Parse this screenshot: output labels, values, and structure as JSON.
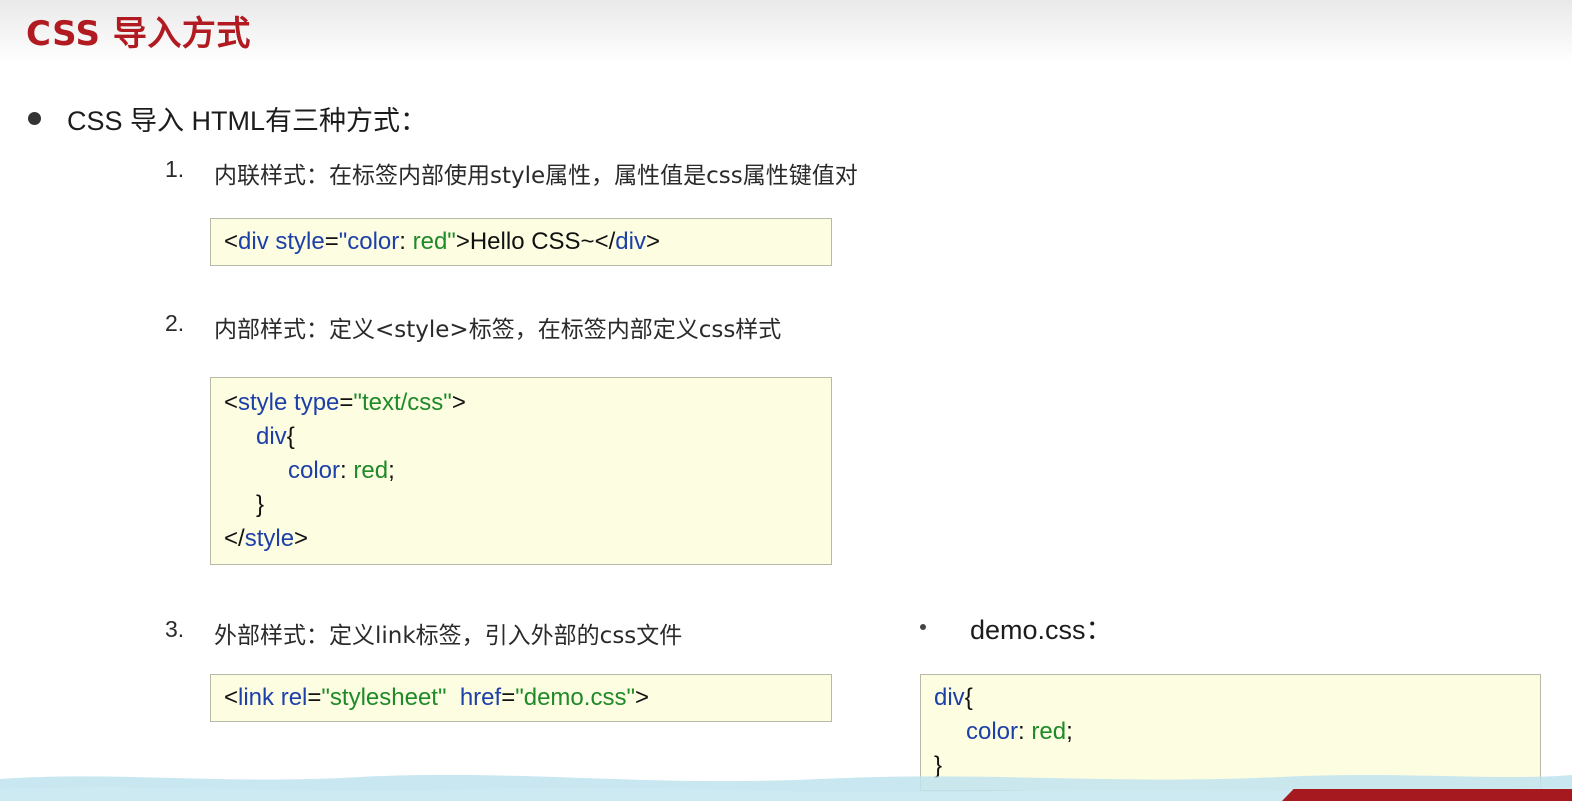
{
  "title": "CSS 导入方式",
  "intro": "CSS 导入 HTML有三种方式：",
  "items": [
    {
      "num": "1.",
      "text": "内联样式：在标签内部使用style属性，属性值是css属性键值对"
    },
    {
      "num": "2.",
      "text": "内部样式：定义<style>标签，在标签内部定义css样式"
    },
    {
      "num": "3.",
      "text": "外部样式：定义link标签，引入外部的css文件"
    }
  ],
  "code1": {
    "lt": "<",
    "tag": "div",
    "attr": " style",
    "eq": "=",
    "val": "\"color",
    "colon": ":",
    "val2": " red\"",
    "gt": ">",
    "content": "Hello CSS~",
    "close_lt": "</",
    "close_tag": "div",
    "close_gt": ">"
  },
  "code2": {
    "l1_lt": "<",
    "l1_tag": "style",
    "l1_attr": " type",
    "l1_eq": "=",
    "l1_val": "\"text/css\"",
    "l1_gt": ">",
    "l2_sel": "div",
    "l2_brace": "{",
    "l3_prop": "color",
    "l3_colon": ":",
    "l3_val": " red",
    "l3_semi": ";",
    "l4": "}",
    "l5_lt": "</",
    "l5_tag": "style",
    "l5_gt": ">"
  },
  "code3": {
    "lt": "<",
    "tag": "link",
    "attr1": " rel",
    "eq1": "=",
    "val1": "\"stylesheet\"",
    "attr2": "  href",
    "eq2": "=",
    "val2": "\"demo.css\"",
    "gt": ">"
  },
  "demo": {
    "title": "demo.css：",
    "sel": "div",
    "brace": "{",
    "prop": "color",
    "colon": ":",
    "val": " red",
    "semi": ";",
    "close": "}"
  },
  "colors": {
    "title": "#b01a20",
    "tag": "#1d3fa8",
    "string": "#1f8a28",
    "code_bg": "#fdfde2"
  }
}
